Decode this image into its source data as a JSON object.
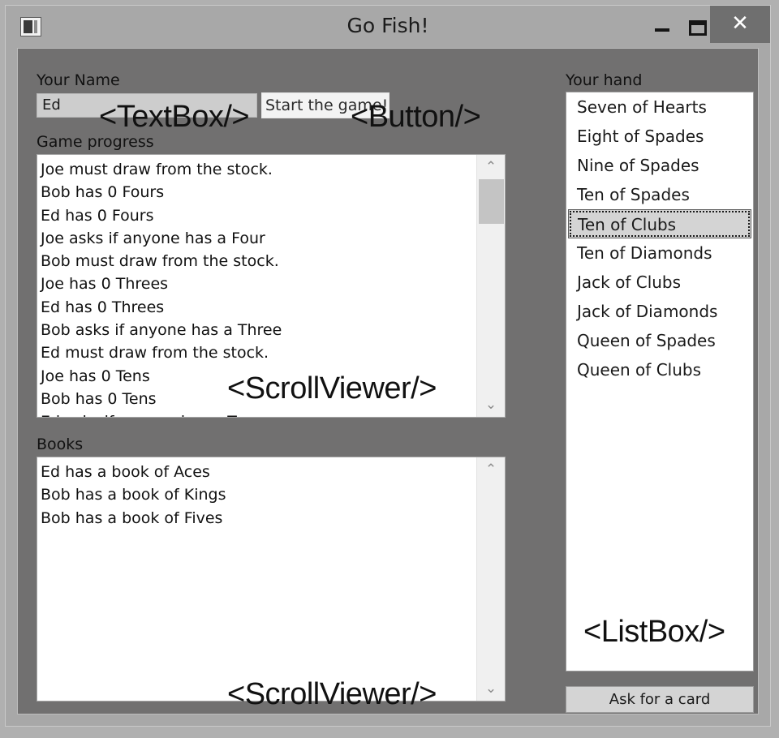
{
  "window": {
    "title": "Go Fish!",
    "icon": "app-window-icon",
    "minimize": "—",
    "maximize": "▭",
    "close": "✕"
  },
  "left": {
    "name_label": "Your Name",
    "name_value": "Ed",
    "name_placeholder": "Your Name",
    "start_button": "Start the game!",
    "progress_label": "Game progress",
    "progress_items": [
      "Joe must draw from the stock.",
      "Bob has 0 Fours",
      "Ed has 0 Fours",
      "Joe asks if anyone has a Four",
      "Bob must draw from the stock.",
      "Joe has 0 Threes",
      "Ed has 0 Threes",
      "Bob asks if anyone has a Three",
      "Ed must draw from the stock.",
      "Joe has 0 Tens",
      "Bob has 0 Tens",
      "Ed asks if anyone has a Ten"
    ],
    "books_label": "Books",
    "books_items": [
      "Ed has a book of Aces",
      "Bob has a book of Kings",
      "Bob has a book of Fives"
    ]
  },
  "right": {
    "hand_label": "Your hand",
    "hand_items": [
      "Seven of Hearts",
      "Eight of Spades",
      "Nine of Spades",
      "Ten of Spades",
      "Ten of Clubs",
      "Ten of Diamonds",
      "Jack of Clubs",
      "Jack of Diamonds",
      "Queen of Spades",
      "Queen of Clubs"
    ],
    "selected_index": 4,
    "ask_button": "Ask for a card"
  },
  "annotations": {
    "textbox": "<TextBox/>",
    "button": "<Button/>",
    "scrollviewer_progress": "<ScrollViewer/>",
    "scrollviewer_books": "<ScrollViewer/>",
    "listbox": "<ListBox/>"
  },
  "scroll": {
    "up_arrow": "⌃",
    "down_arrow": "⌄"
  },
  "colors": {
    "window_chrome": "#a8a8a8",
    "client_background": "#717070",
    "control_surface": "#ffffff",
    "close_button": "#6f6f6f",
    "selection": "#d4d4d4"
  }
}
